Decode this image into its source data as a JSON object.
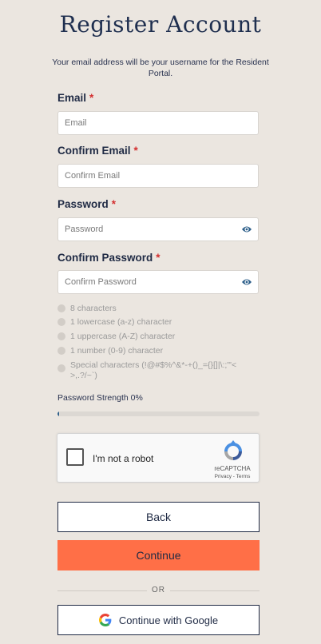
{
  "title": "Register Account",
  "subtitle": "Your email address will be your username for the Resident Portal.",
  "fields": {
    "email": {
      "label": "Email",
      "required": "*",
      "placeholder": "Email",
      "value": ""
    },
    "confirm_email": {
      "label": "Confirm Email",
      "required": "*",
      "placeholder": "Confirm Email",
      "value": ""
    },
    "password": {
      "label": "Password",
      "required": "*",
      "placeholder": "Password",
      "value": ""
    },
    "confirm_password": {
      "label": "Confirm Password",
      "required": "*",
      "placeholder": "Confirm Password",
      "value": ""
    }
  },
  "password_rules": [
    "8 characters",
    "1 lowercase (a-z) character",
    "1 uppercase (A-Z) character",
    "1 number (0-9) character",
    "Special characters (!@#$%^&*-+()_={}[]|\\:;\"'<>,.?/~`)"
  ],
  "strength": {
    "label": "Password Strength 0%",
    "percent": 0
  },
  "captcha": {
    "label": "I'm not a robot",
    "brand": "reCAPTCHA",
    "links": "Privacy - Terms",
    "checked": false
  },
  "buttons": {
    "back": "Back",
    "continue": "Continue",
    "google": "Continue with Google"
  },
  "divider": "OR",
  "colors": {
    "accent": "#ff6f47",
    "navy": "#1f2a44",
    "background": "#ebe6e0",
    "required": "#d32f2f",
    "eye_icon": "#2d5f8a"
  },
  "icons": {
    "password_toggle": "eye-icon",
    "google": "google-logo-icon",
    "captcha": "recaptcha-logo-icon"
  }
}
